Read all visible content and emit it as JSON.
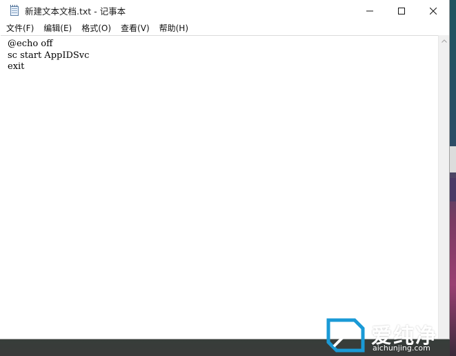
{
  "window": {
    "title": "新建文本文档.txt - 记事本",
    "app_icon": "notepad-icon",
    "caption_buttons": [
      {
        "name": "minimize",
        "icon": "minimize-icon"
      },
      {
        "name": "maximize",
        "icon": "maximize-icon"
      },
      {
        "name": "close",
        "icon": "close-icon"
      }
    ]
  },
  "menubar": {
    "items": [
      {
        "label": "文件(F)"
      },
      {
        "label": "编辑(E)"
      },
      {
        "label": "格式(O)"
      },
      {
        "label": "查看(V)"
      },
      {
        "label": "帮助(H)"
      }
    ]
  },
  "editor": {
    "lines": [
      "@echo off",
      "sc start AppIDSvc",
      "exit"
    ]
  },
  "scrollbar": {
    "up_icon": "chevron-up-icon",
    "down_icon": "chevron-down-icon"
  },
  "watermark": {
    "brand": "爱纯净",
    "url": "aichunjing.com"
  },
  "colors": {
    "window_bg": "#ffffff",
    "text": "#000000",
    "watermark": "#ffffff"
  }
}
